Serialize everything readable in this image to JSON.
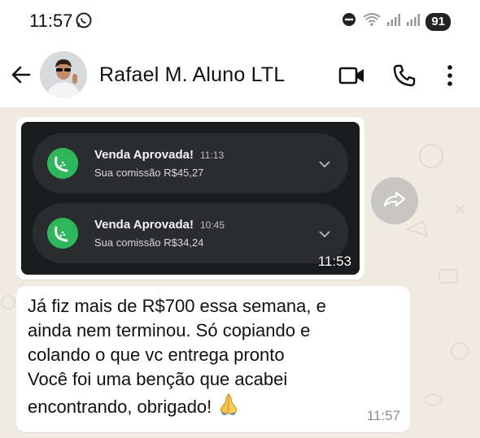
{
  "status_bar": {
    "time": "11:57",
    "battery": "91"
  },
  "header": {
    "contact_name": "Rafael M. Aluno LTL"
  },
  "image_message": {
    "notifications": [
      {
        "title": "Venda Aprovada!",
        "time": "11:13",
        "subtitle": "Sua comissão R$45,27"
      },
      {
        "title": "Venda Aprovada!",
        "time": "10:45",
        "subtitle": "Sua comissão R$34,24"
      }
    ],
    "time": "11:53"
  },
  "text_message": {
    "lines": [
      "Já fiz mais de R$700 essa semana, e",
      "ainda nem terminou. Só copiando e",
      "colando o que vc entrega pronto",
      "Você foi uma benção que acabei",
      "encontrando, obrigado!"
    ],
    "time": "11:57"
  },
  "icons": {
    "back": "arrow-left-icon",
    "video": "video-camera-icon",
    "phone": "phone-icon",
    "menu": "more-vert-icon",
    "forward": "forward-icon"
  },
  "colors": {
    "chat_background": "#efeae2",
    "notification_icon": "#2db75a",
    "screenshot_background": "#1b1c1e"
  }
}
